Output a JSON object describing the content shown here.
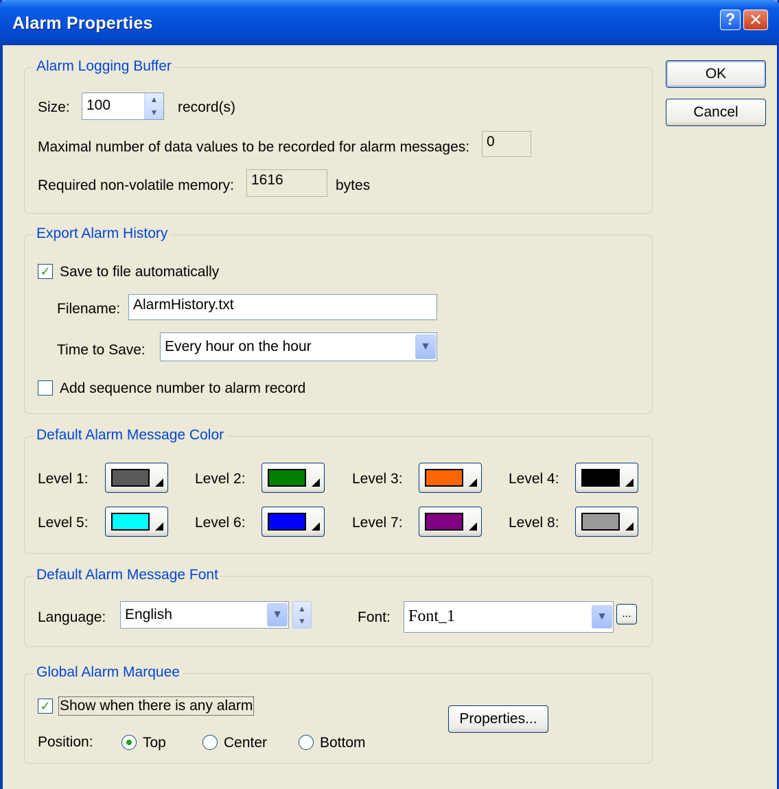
{
  "window": {
    "title": "Alarm Properties"
  },
  "titlebar_buttons": {
    "help": "?",
    "close": "✕"
  },
  "buttons": {
    "ok": "OK",
    "cancel": "Cancel"
  },
  "logging": {
    "legend": "Alarm Logging Buffer",
    "size_label": "Size:",
    "size_value": "100",
    "size_unit": "record(s)",
    "maxvals_label": "Maximal number of data values to be recorded for alarm messages:",
    "maxvals_value": "0",
    "memory_label": "Required non-volatile memory:",
    "memory_value": "1616",
    "memory_unit": "bytes"
  },
  "export": {
    "legend": "Export Alarm History",
    "save_auto_label": "Save to file automatically",
    "save_auto_checked": true,
    "filename_label": "Filename:",
    "filename_value": "AlarmHistory.txt",
    "time_label": "Time to Save:",
    "time_value": "Every hour on the hour",
    "seq_label": "Add sequence number to alarm record",
    "seq_checked": false
  },
  "colors": {
    "legend": "Default Alarm Message Color",
    "levels": [
      {
        "label": "Level 1:",
        "color": "#595959"
      },
      {
        "label": "Level 2:",
        "color": "#007F00"
      },
      {
        "label": "Level 3:",
        "color": "#FF6600"
      },
      {
        "label": "Level 4:",
        "color": "#000000"
      },
      {
        "label": "Level 5:",
        "color": "#00FFFF"
      },
      {
        "label": "Level 6:",
        "color": "#0000FF"
      },
      {
        "label": "Level 7:",
        "color": "#800080"
      },
      {
        "label": "Level 8:",
        "color": "#999999"
      }
    ]
  },
  "font": {
    "legend": "Default Alarm Message Font",
    "language_label": "Language:",
    "language_value": "English",
    "font_label": "Font:",
    "font_value": "Font_1",
    "browse_label": "..."
  },
  "marquee": {
    "legend": "Global Alarm Marquee",
    "show_label": "Show when there is any alarm",
    "show_checked": true,
    "properties_label": "Properties...",
    "position_label": "Position:",
    "positions": [
      {
        "label": "Top",
        "selected": true
      },
      {
        "label": "Center",
        "selected": false
      },
      {
        "label": "Bottom",
        "selected": false
      }
    ]
  }
}
